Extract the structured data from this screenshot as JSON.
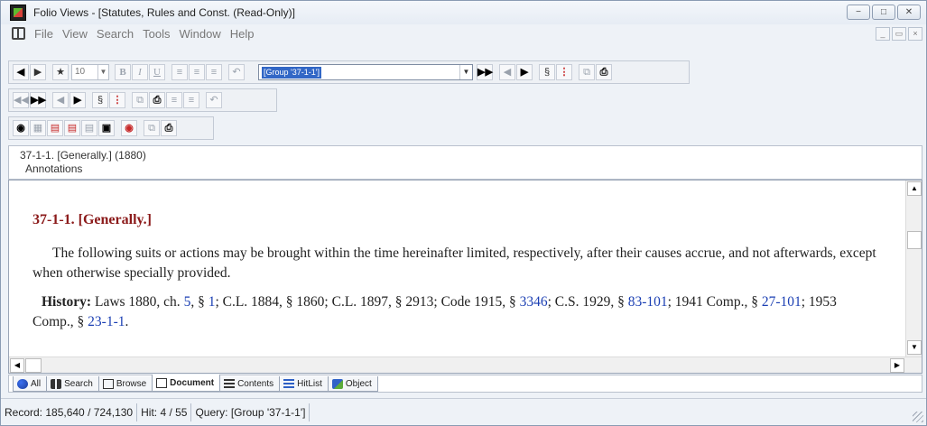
{
  "window": {
    "title": "Folio Views - [Statutes, Rules and Const. (Read-Only)]",
    "controls": [
      "−",
      "□",
      "✕"
    ],
    "accent": "#3267c6"
  },
  "menubar": {
    "items": [
      "File",
      "View",
      "Search",
      "Tools",
      "Window",
      "Help"
    ],
    "mdi_controls": [
      "_",
      " ̅❒",
      "×"
    ]
  },
  "toolbar1": {
    "font_size": "10",
    "bold": "B",
    "italic": "I",
    "underline": "U",
    "query_value": "[Group '37-1-1']"
  },
  "breadcrumb": {
    "line1": "37-1-1. [Generally.]  (1880)",
    "line2": "Annotations"
  },
  "document": {
    "heading": "37-1-1. [Generally.]",
    "paragraph": "The following suits or actions may be brought within the time hereinafter limited, respectively, after their causes accrue, and not afterwards, except when otherwise specially provided.",
    "history": {
      "label": "History:",
      "p1": "Laws 1880, ch. ",
      "l1": "5",
      "p2": ", § ",
      "l2": "1",
      "p3": "; C.L. 1884, § 1860; C.L. 1897, § 2913; Code 1915, § ",
      "l3": "3346",
      "p4": "; C.S. 1929, § ",
      "l4": "83-101",
      "p5": "; 1941 Comp., § ",
      "l5": "27-101",
      "p6": "; 1953 Comp., § ",
      "l6": "23-1-1",
      "p7": "."
    },
    "heading_color": "#8b1a1a",
    "link_color": "#1b3fb3"
  },
  "tabs": [
    {
      "label": "All",
      "icon": "globe-icon"
    },
    {
      "label": "Search",
      "icon": "binoculars-icon"
    },
    {
      "label": "Browse",
      "icon": "book-icon"
    },
    {
      "label": "Document",
      "icon": "document-icon",
      "active": true
    },
    {
      "label": "Contents",
      "icon": "contents-icon"
    },
    {
      "label": "HitList",
      "icon": "hitlist-icon"
    },
    {
      "label": "Object",
      "icon": "object-icon"
    }
  ],
  "status": {
    "record": "Record: 185,640 / 724,130",
    "hit": "Hit: 4 / 55",
    "query": "Query: [Group '37-1-1']"
  }
}
